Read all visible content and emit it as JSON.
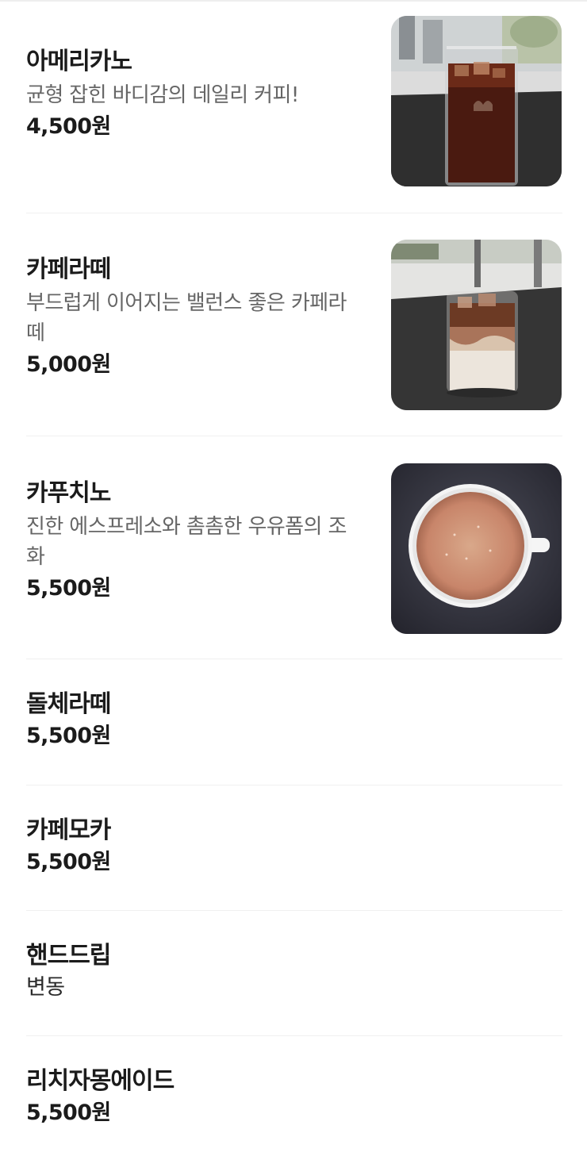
{
  "menu": {
    "items": [
      {
        "name": "아메리카노",
        "description": "균형 잡힌 바디감의 데일리 커피!",
        "price": "4,500원",
        "image": "iced-americano-photo"
      },
      {
        "name": "카페라떼",
        "description": "부드럽게 이어지는 밸런스 좋은 카페라떼",
        "price": "5,000원",
        "image": "iced-cafe-latte-photo"
      },
      {
        "name": "카푸치노",
        "description": "진한 에스프레소와 촘촘한 우유폼의 조화",
        "price": "5,500원",
        "image": "cappuccino-photo"
      },
      {
        "name": "돌체라떼",
        "price": "5,500원"
      },
      {
        "name": "카페모카",
        "price": "5,500원"
      },
      {
        "name": "핸드드립",
        "price": "변동"
      },
      {
        "name": "리치자몽에이드",
        "price": "5,500원"
      }
    ]
  }
}
